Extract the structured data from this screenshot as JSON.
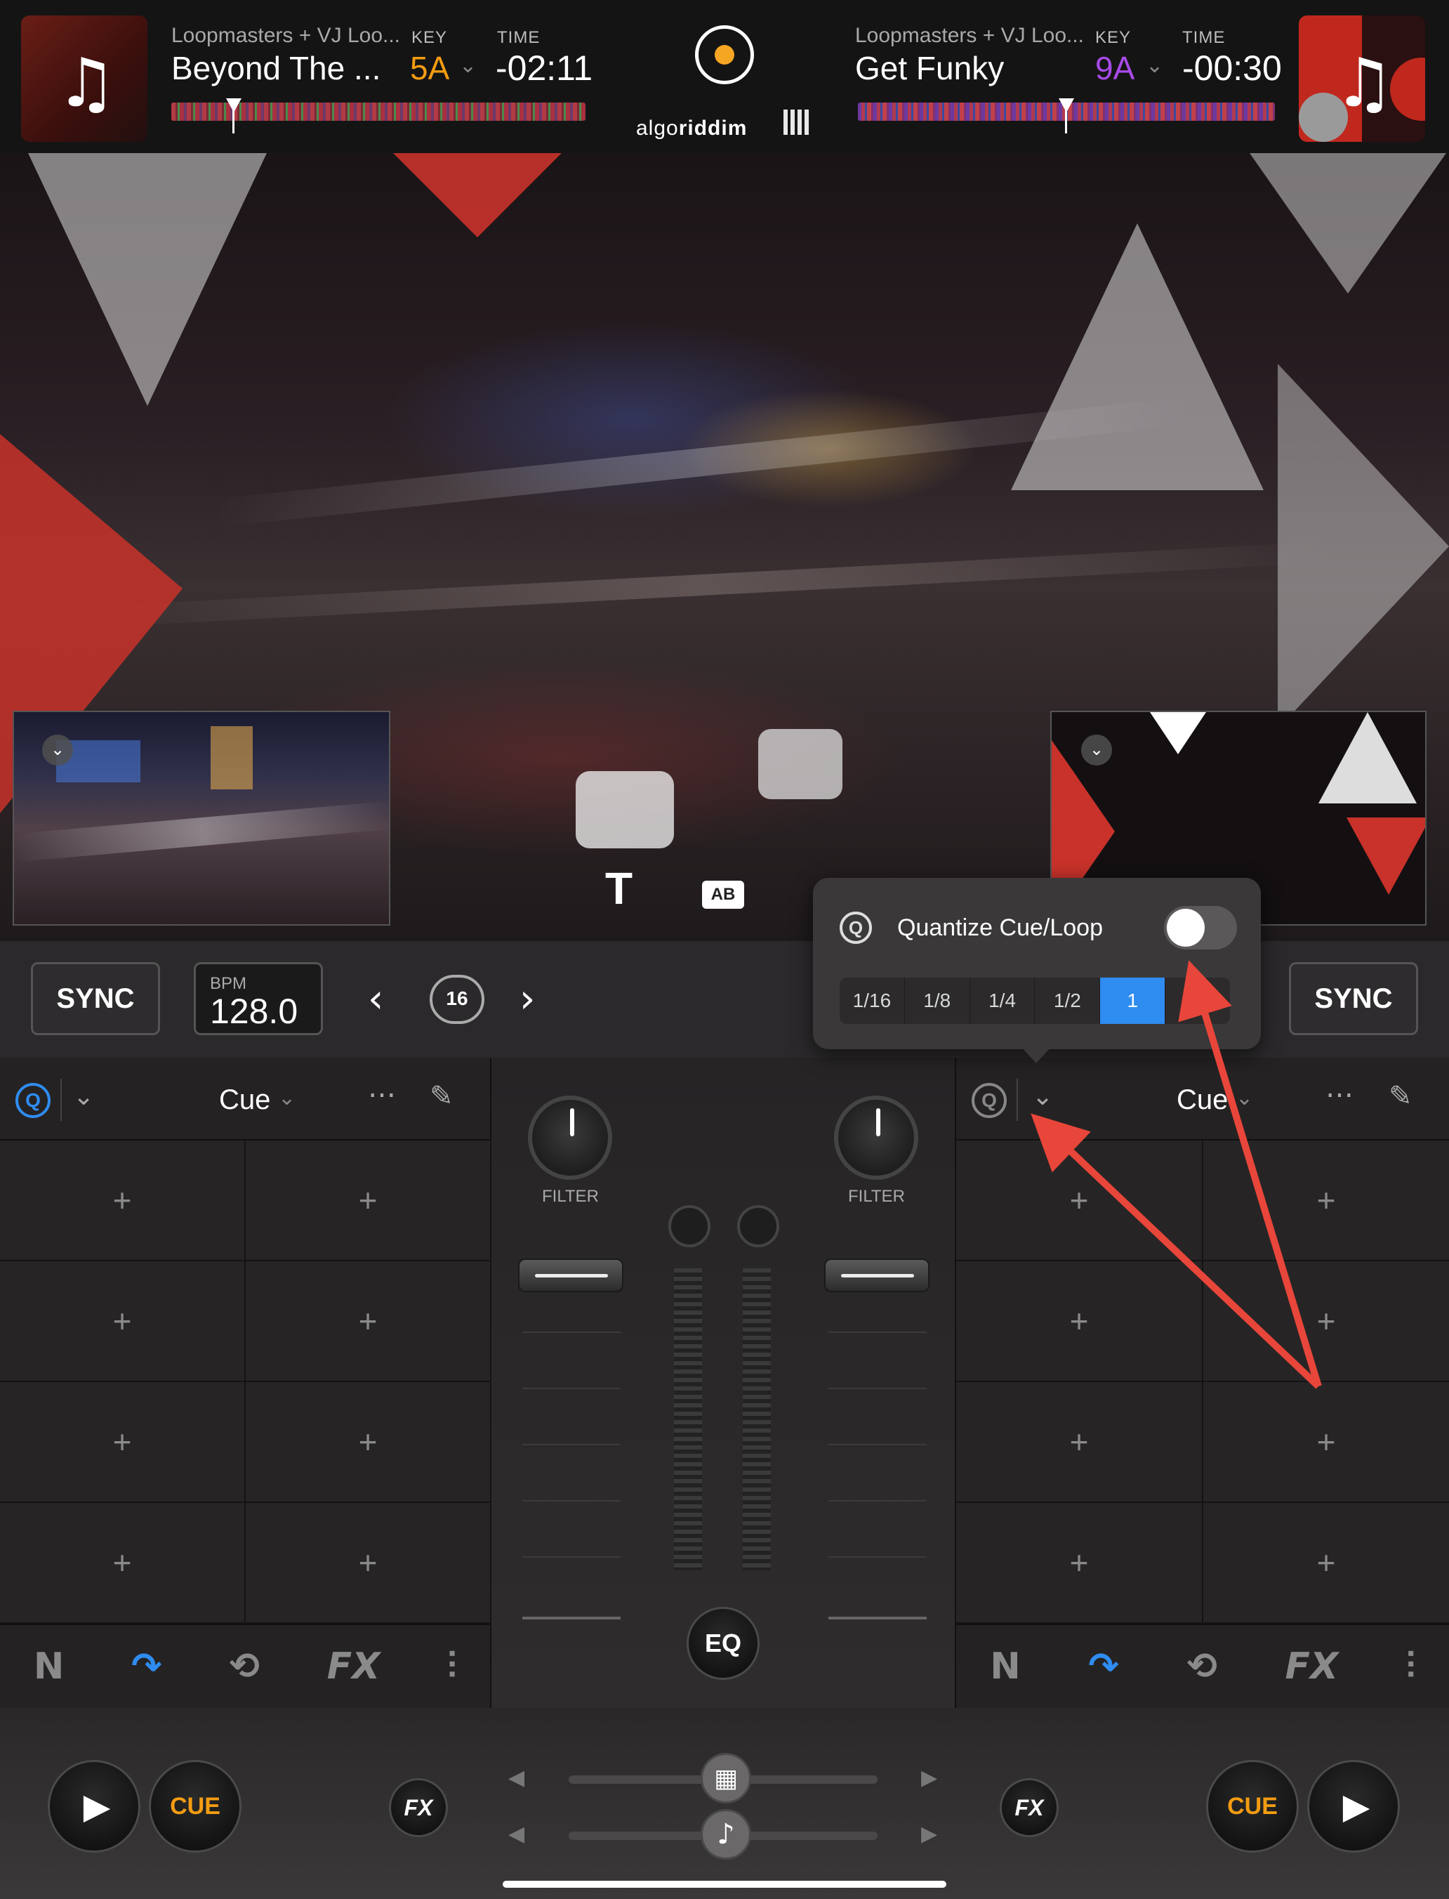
{
  "deck_left": {
    "artist": "Loopmasters + VJ Loo...",
    "title": "Beyond The ...",
    "key_label": "KEY",
    "key": "5A",
    "key_color": "#f39c12",
    "time_label": "TIME",
    "time": "-02:11"
  },
  "deck_right": {
    "artist": "Loopmasters + VJ Loo...",
    "title": "Get Funky",
    "key_label": "KEY",
    "key": "9A",
    "key_color": "#a84be8",
    "time_label": "TIME",
    "time": "-00:30"
  },
  "brand": {
    "text_a": "algo",
    "text_b": "riddim"
  },
  "controls": {
    "sync_left": "SYNC",
    "sync_right": "SYNC",
    "bpm_label": "BPM",
    "bpm_value": "128.0",
    "loop_value": "16"
  },
  "popover": {
    "title": "Quantize Cue/Loop",
    "options": [
      "1/16",
      "1/8",
      "1/4",
      "1/2",
      "1",
      ""
    ],
    "selected_index": 4
  },
  "pad_panel_left": {
    "mode": "Cue"
  },
  "pad_panel_right": {
    "mode": "Cue"
  },
  "mixer": {
    "filter_left": "FILTER",
    "filter_right": "FILTER",
    "eq": "EQ"
  },
  "bottom": {
    "cue_left": "CUE",
    "cue_right": "CUE",
    "fx_left": "FX",
    "fx_right": "FX"
  },
  "colors": {
    "accent": "#2f8cf0",
    "cue": "#f39c12",
    "annotation": "#e8463a"
  }
}
